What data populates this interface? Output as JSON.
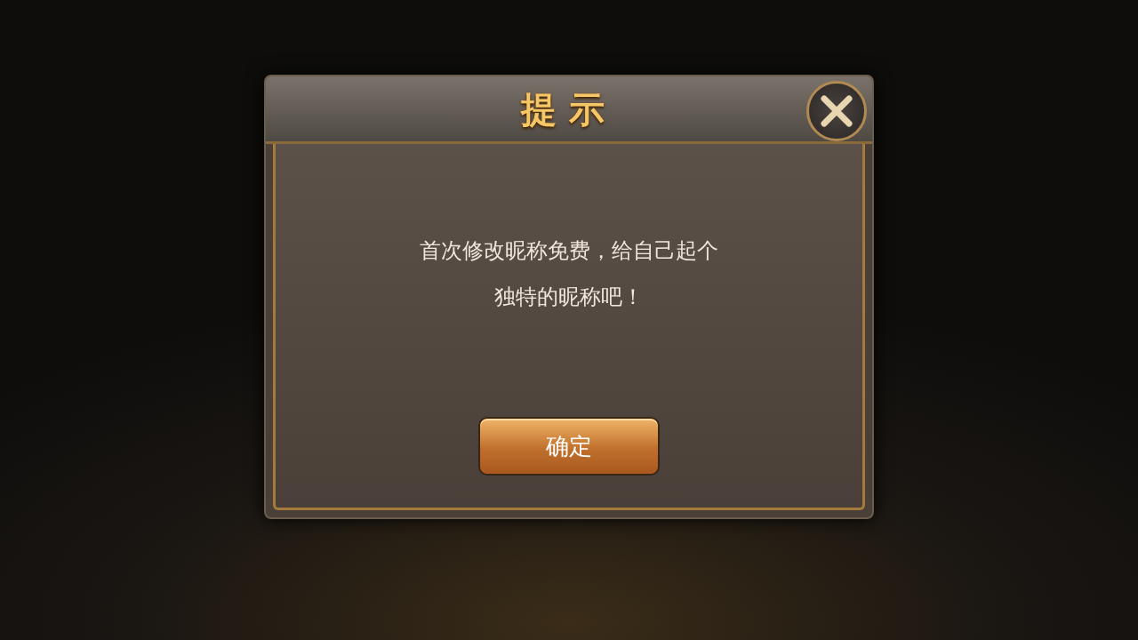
{
  "dialog": {
    "title": "提示",
    "message": "首次修改昵称免费，给自己起个独特的昵称吧！",
    "buttons": [
      {
        "label": "确定"
      }
    ]
  }
}
